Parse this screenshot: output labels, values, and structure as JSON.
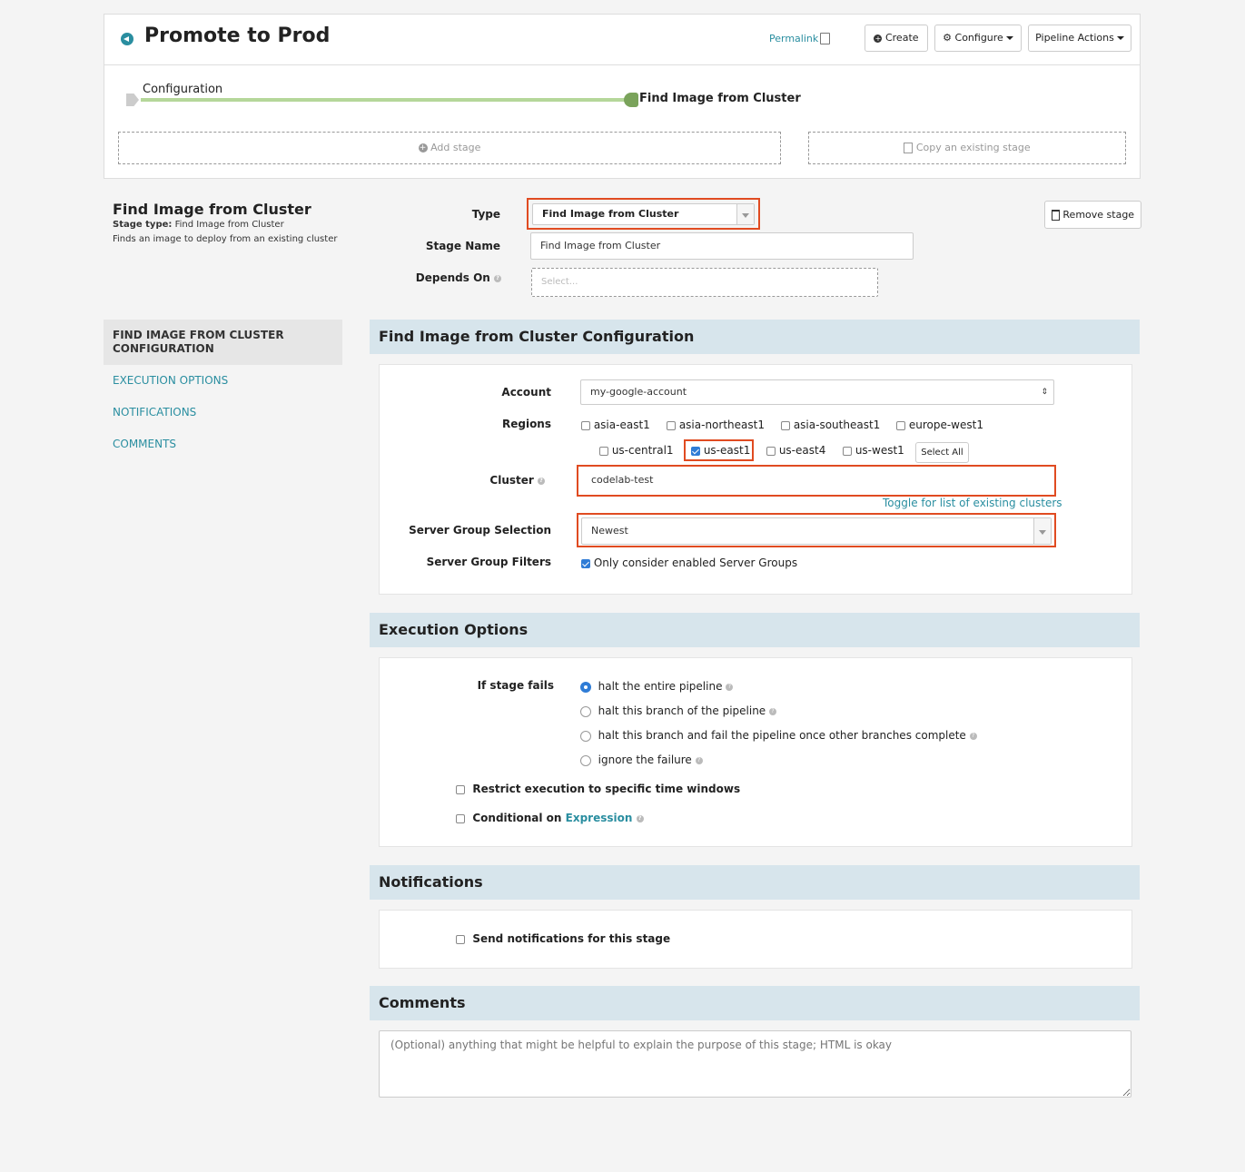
{
  "header": {
    "title": "Promote to Prod",
    "permalink": "Permalink",
    "create": "Create",
    "configure": "Configure",
    "pipeline_actions": "Pipeline Actions"
  },
  "timeline": {
    "start_label": "Configuration",
    "end_label": "Find Image from Cluster",
    "add_stage": "Add stage",
    "copy_stage": "Copy an existing stage"
  },
  "stage": {
    "heading": "Find Image from Cluster",
    "type_prefix": "Stage type:",
    "type_value": "Find Image from Cluster",
    "description": "Finds an image to deploy from an existing cluster",
    "type_label": "Type",
    "type_selected": "Find Image from Cluster",
    "name_label": "Stage Name",
    "name_value": "Find Image from Cluster",
    "depends_label": "Depends On",
    "depends_placeholder": "Select...",
    "remove": "Remove stage"
  },
  "sidenav": {
    "active": "FIND IMAGE FROM CLUSTER CONFIGURATION",
    "items": [
      "EXECUTION OPTIONS",
      "NOTIFICATIONS",
      "COMMENTS"
    ]
  },
  "config": {
    "title": "Find Image from Cluster Configuration",
    "account_label": "Account",
    "account_value": "my-google-account",
    "regions_label": "Regions",
    "regions": [
      "asia-east1",
      "asia-northeast1",
      "asia-southeast1",
      "europe-west1",
      "us-central1",
      "us-east1",
      "us-east4",
      "us-west1"
    ],
    "select_all": "Select All",
    "cluster_label": "Cluster",
    "cluster_value": "codelab-test",
    "toggle_clusters": "Toggle for list of existing clusters",
    "sgs_label": "Server Group Selection",
    "sgs_value": "Newest",
    "sgf_label": "Server Group Filters",
    "sgf_option": "Only consider enabled Server Groups"
  },
  "execution": {
    "title": "Execution Options",
    "fails_label": "If stage fails",
    "options": [
      "halt the entire pipeline",
      "halt this branch of the pipeline",
      "halt this branch and fail the pipeline once other branches complete",
      "ignore the failure"
    ],
    "restrict": "Restrict execution to specific time windows",
    "conditional": "Conditional on",
    "expression": "Expression"
  },
  "notifications": {
    "title": "Notifications",
    "send": "Send notifications for this stage"
  },
  "comments": {
    "title": "Comments",
    "placeholder": "(Optional) anything that might be helpful to explain the purpose of this stage; HTML is okay"
  },
  "colors": {
    "accent": "#2a8ea0",
    "highlight": "#e04b21",
    "section_bg": "#d7e5ec"
  }
}
